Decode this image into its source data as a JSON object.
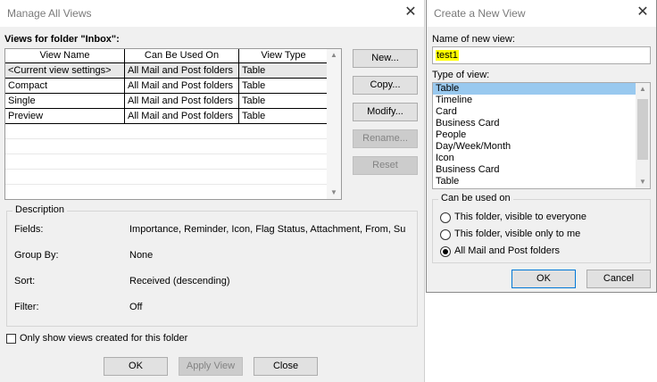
{
  "manage": {
    "title": "Manage All Views",
    "views_label": "Views for folder \"Inbox\":",
    "columns": [
      "View Name",
      "Can Be Used On",
      "View Type"
    ],
    "rows": [
      [
        "<Current view settings>",
        "All Mail and Post folders",
        "Table"
      ],
      [
        "Compact",
        "All Mail and Post folders",
        "Table"
      ],
      [
        "Single",
        "All Mail and Post folders",
        "Table"
      ],
      [
        "Preview",
        "All Mail and Post folders",
        "Table"
      ]
    ],
    "buttons": {
      "new": "New...",
      "copy": "Copy...",
      "modify": "Modify...",
      "rename": "Rename...",
      "reset": "Reset"
    },
    "description": {
      "title": "Description",
      "fields_label": "Fields:",
      "fields_value": "Importance, Reminder, Icon, Flag Status, Attachment, From, Su",
      "group_label": "Group By:",
      "group_value": "None",
      "sort_label": "Sort:",
      "sort_value": "Received (descending)",
      "filter_label": "Filter:",
      "filter_value": "Off"
    },
    "only_show_label": "Only show views created for this folder",
    "footer": {
      "ok": "OK",
      "apply": "Apply View",
      "close": "Close"
    }
  },
  "create": {
    "title": "Create a New View",
    "name_label": "Name of new view:",
    "name_value": "test1",
    "type_label": "Type of view:",
    "types": [
      "Table",
      "Timeline",
      "Card",
      "Business Card",
      "People",
      "Day/Week/Month",
      "Icon",
      "Business Card",
      "Table"
    ],
    "can_be_used_title": "Can be used on",
    "options": [
      "This folder, visible to everyone",
      "This folder, visible only to me",
      "All Mail and Post folders"
    ],
    "selected_option": 2,
    "ok": "OK",
    "cancel": "Cancel"
  }
}
